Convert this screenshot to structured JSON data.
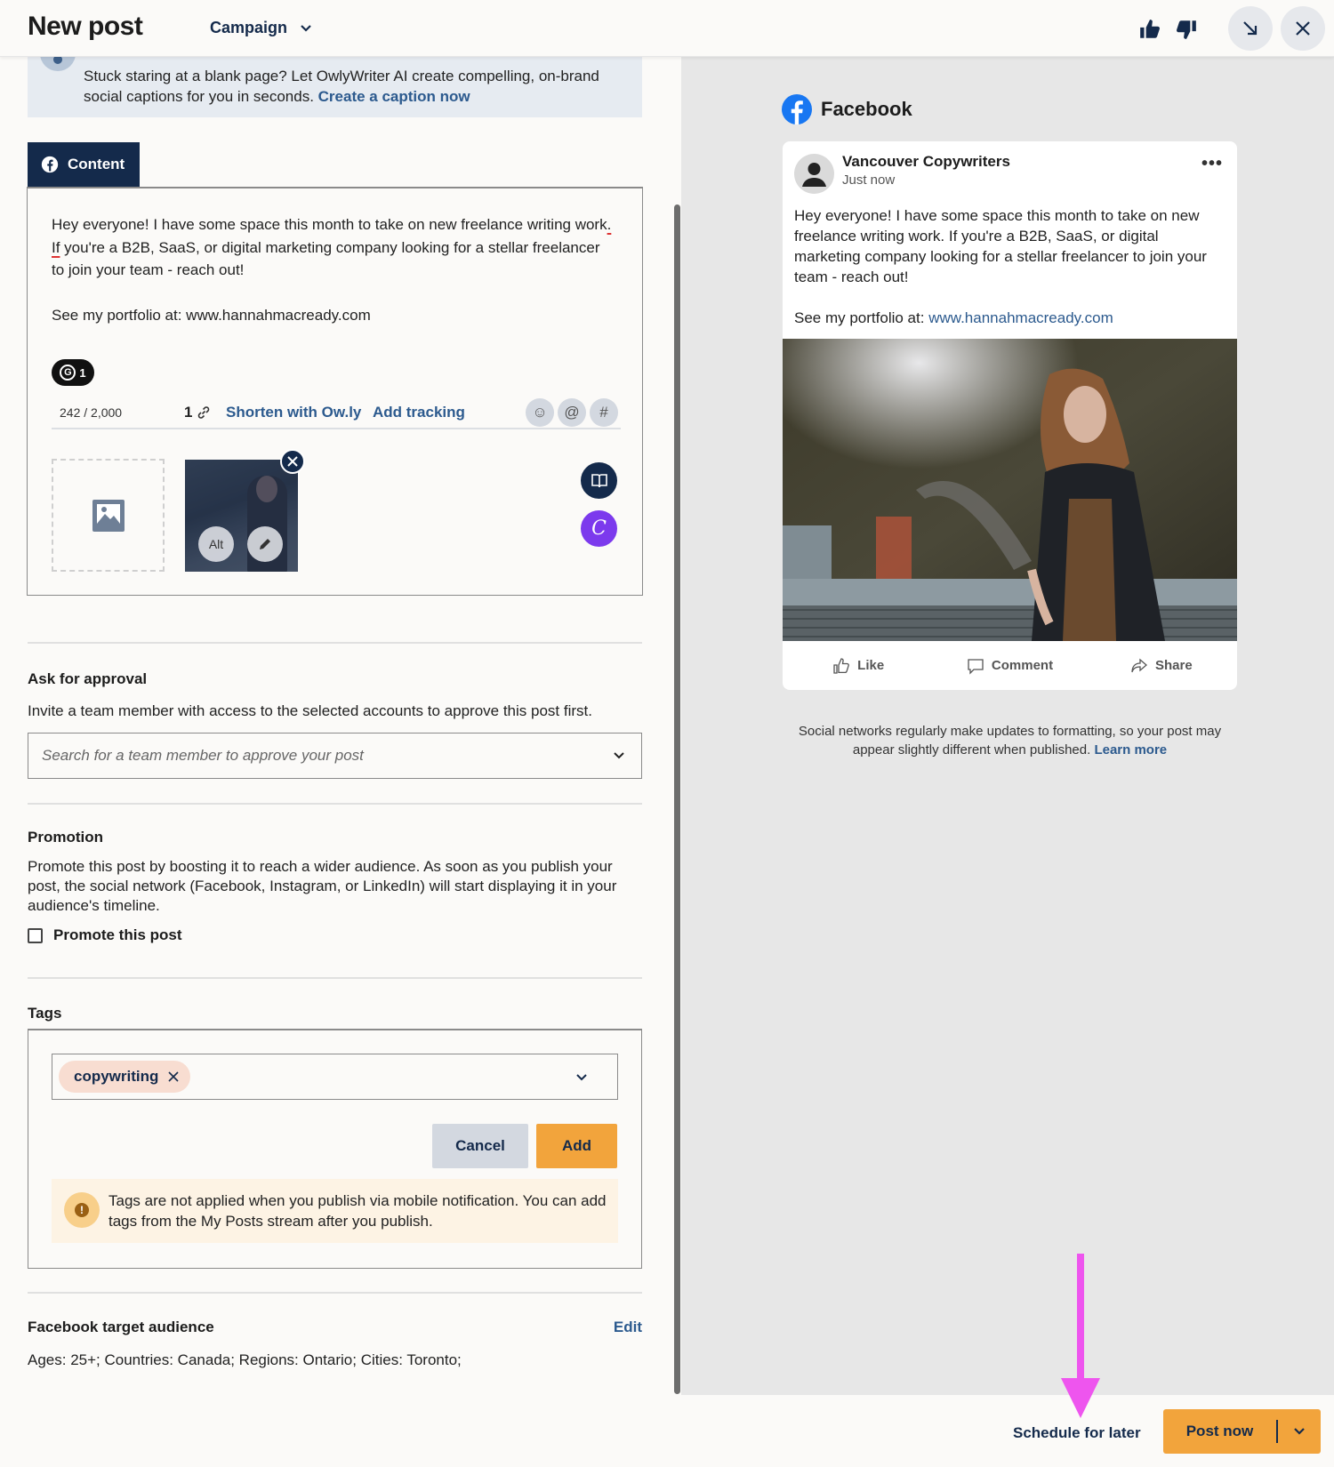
{
  "header": {
    "title": "New post",
    "campaign_label": "Campaign",
    "icons": [
      "thumbs-up-icon",
      "thumbs-down-icon",
      "minimize-icon",
      "close-icon"
    ]
  },
  "ai_banner": {
    "text": "Stuck staring at a blank page? Let OwlyWriter AI create compelling, on-brand social captions for you in seconds.",
    "link": "Create a caption now"
  },
  "composer": {
    "tab_label": "Content",
    "text_line1_pre": "Hey everyone! I have some space this month to take on new freelance writing work",
    "text_line1_end": ".",
    "text_line2_first": "If",
    "text_line2_rest": " you're a B2B, SaaS, or digital marketing company looking for a stellar freelancer to join your team - reach out!",
    "text_portfolio": "See my portfolio at: www.hannahmacready.com",
    "grammarly_count": "1",
    "char_count": "242 / 2,000",
    "link_count": "1",
    "shorten_label": "Shorten with Ow.ly",
    "tracking_label": "Add tracking",
    "emoji_label": "☺",
    "mention_label": "@",
    "hashtag_label": "#",
    "alt_label": "Alt",
    "canva_label": "C"
  },
  "approval": {
    "title": "Ask for approval",
    "description": "Invite a team member with access to the selected accounts to approve this post first.",
    "placeholder": "Search for a team member to approve your post"
  },
  "promotion": {
    "title": "Promotion",
    "description": "Promote this post by boosting it to reach a wider audience. As soon as you publish your post, the social network (Facebook, Instagram, or LinkedIn) will start displaying it in your audience's timeline.",
    "checkbox_label": "Promote this post",
    "checked": false
  },
  "tags": {
    "title": "Tags",
    "chips": [
      "copywriting"
    ],
    "cancel_label": "Cancel",
    "add_label": "Add",
    "note": "Tags are not applied when you publish via mobile notification. You can add tags from the My Posts stream after you publish."
  },
  "audience": {
    "title": "Facebook target audience",
    "edit_label": "Edit",
    "summary": "Ages: 25+; Countries: Canada; Regions: Ontario; Cities: Toronto;"
  },
  "preview": {
    "network": "Facebook",
    "account_name": "Vancouver Copywriters",
    "timestamp": "Just now",
    "body": "Hey everyone! I have some space this month to take on new freelance writing work. If you're a B2B, SaaS, or digital marketing company looking for a stellar freelancer to join your team - reach out!",
    "portfolio_prefix": "See my portfolio at: ",
    "portfolio_link": "www.hannahmacready.com",
    "actions": [
      "Like",
      "Comment",
      "Share"
    ],
    "note": "Social networks regularly make updates to formatting, so your post may appear slightly different when published.",
    "note_link": "Learn more"
  },
  "footer": {
    "schedule_label": "Schedule for later",
    "post_now_label": "Post now"
  },
  "colors": {
    "navy": "#142a4b",
    "accent_orange": "#f2a43c",
    "link_blue": "#2c5a8e",
    "facebook_blue": "#1877f2",
    "canva_purple": "#7c3aed",
    "annotation_magenta": "#ee55ee"
  }
}
